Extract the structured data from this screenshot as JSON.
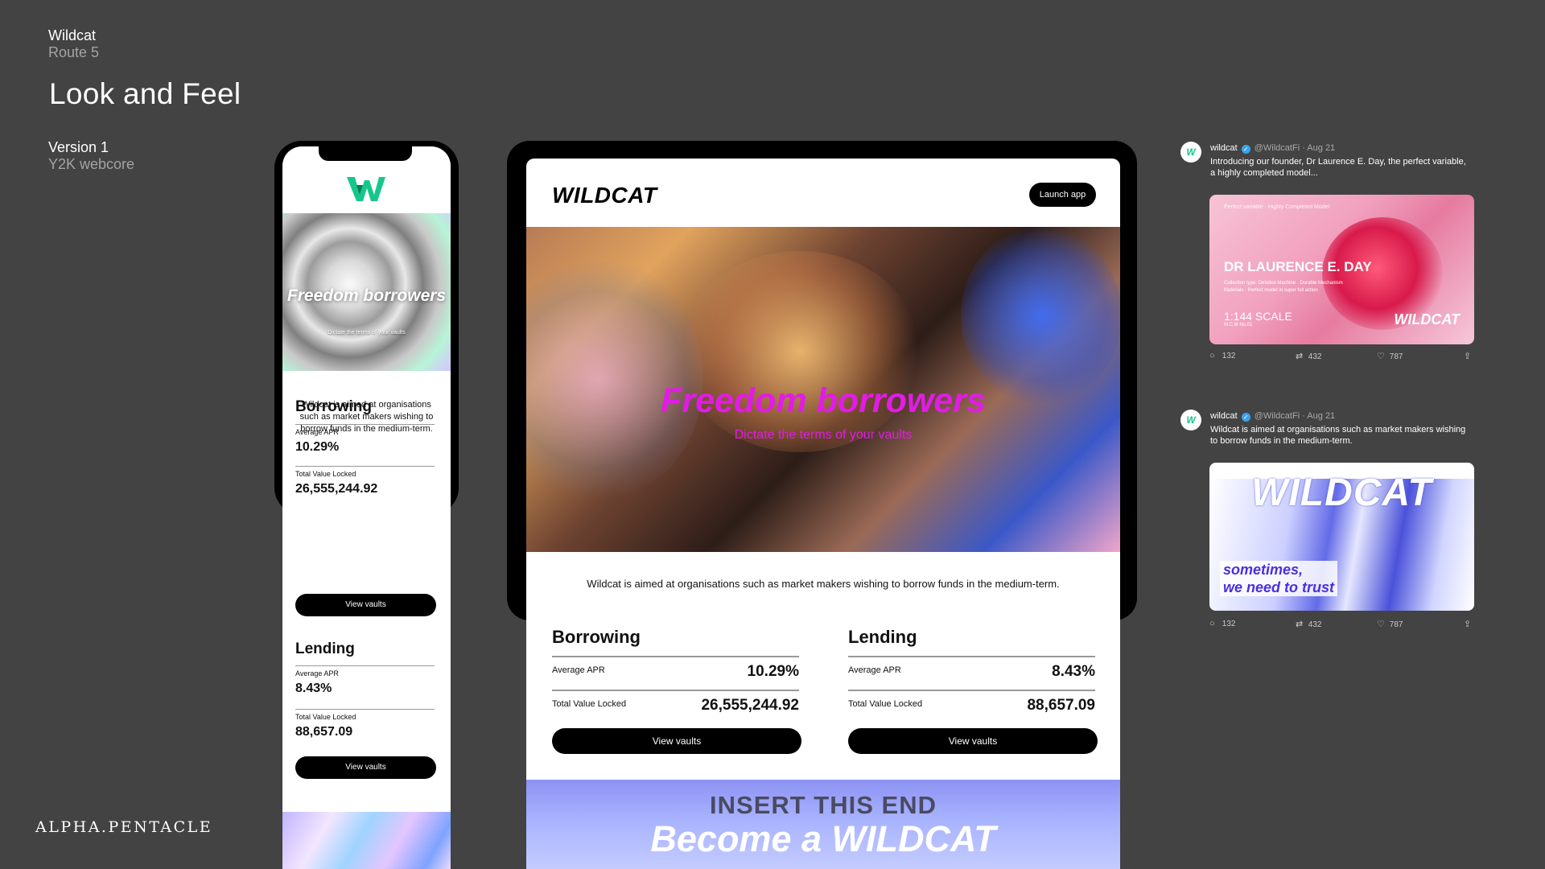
{
  "brand": {
    "name": "Wildcat",
    "route": "Route 5"
  },
  "page_title": "Look and Feel",
  "version": {
    "title": "Version 1",
    "subtitle": "Y2K webcore"
  },
  "footer_logo": "ALPHA.PENTACLE",
  "phone": {
    "logo": "W",
    "hero_title": "Freedom borrowers",
    "hero_subtitle": "Dictate the terms of your vaults",
    "description": "Wildcat is aimed at organisations such as market makers wishing to borrow funds in the medium-term.",
    "borrowing": {
      "title": "Borrowing",
      "apr_label": "Average APR",
      "apr_value": "10.29%",
      "tvl_label": "Total Value Locked",
      "tvl_value": "26,555,244.92",
      "button": "View vaults"
    },
    "lending": {
      "title": "Lending",
      "apr_label": "Average APR",
      "apr_value": "8.43%",
      "tvl_label": "Total Value Locked",
      "tvl_value": "88,657.09",
      "button": "View vaults"
    }
  },
  "tablet": {
    "logo": "WILDCAT",
    "launch_button": "Launch app",
    "hero_title": "Freedom borrowers",
    "hero_subtitle": "Dictate the terms of your vaults",
    "description": "Wildcat is aimed at organisations such as market makers wishing to borrow funds in the medium-term.",
    "borrowing": {
      "title": "Borrowing",
      "apr_label": "Average APR",
      "apr_value": "10.29%",
      "tvl_label": "Total Value Locked",
      "tvl_value": "26,555,244.92",
      "button": "View vaults"
    },
    "lending": {
      "title": "Lending",
      "apr_label": "Average APR",
      "apr_value": "8.43%",
      "tvl_label": "Total Value Locked",
      "tvl_value": "88,657.09",
      "button": "View vaults"
    },
    "bottom_small": "INSERT THIS END",
    "bottom_big": "Become a WILDCAT"
  },
  "tweets": [
    {
      "avatar": "W",
      "name": "wildcat",
      "meta": "@WildcatFi · Aug 21",
      "text": "Introducing our founder, Dr Laurence E. Day, the perfect variable, a highly completed model...",
      "media": {
        "small": "Perfect variable · Highly Completed Model",
        "title": "DR LAURENCE E. DAY",
        "meta": "Collection type: Detailed Machine · Durable Mechanism Materials · Perfect model in super full action",
        "scale": "1:144 SCALE",
        "scale_sub": "M.C.M    No.01",
        "watermark": "WILDCAT"
      },
      "replies": "132",
      "retweets": "432",
      "likes": "787"
    },
    {
      "avatar": "W",
      "name": "wildcat",
      "meta": "@WildcatFi · Aug 21",
      "text": "Wildcat is aimed at organisations such as market makers wishing to borrow funds in the medium-term.",
      "media": {
        "title": "WILDCAT",
        "quote_line1": "sometimes,",
        "quote_line2": "we need to trust"
      },
      "replies": "132",
      "retweets": "432",
      "likes": "787"
    }
  ],
  "colors": {
    "background": "#434343",
    "accent_magenta": "#e21be6",
    "brand_green": "#16c78b",
    "quote_purple": "#4b2fe0"
  },
  "icons": [
    "reply-icon",
    "retweet-icon",
    "like-icon",
    "share-icon",
    "verified-icon"
  ]
}
